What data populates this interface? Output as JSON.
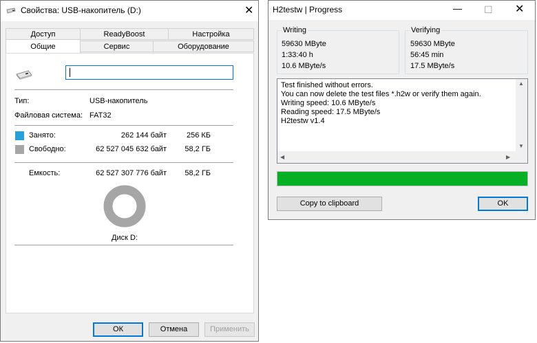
{
  "props_dialog": {
    "title": "Свойства: USB-накопитель (D:)",
    "close_glyph": "✕",
    "tabs_row1": [
      "Доступ",
      "ReadyBoost",
      "Настройка"
    ],
    "tabs_row2": [
      "Общие",
      "Сервис",
      "Оборудование"
    ],
    "selected_tab": "Общие",
    "name_value": "",
    "type_label": "Тип:",
    "type_value": "USB-накопитель",
    "fs_label": "Файловая система:",
    "fs_value": "FAT32",
    "used_label": "Занято:",
    "used_bytes": "262 144 байт",
    "used_short": "256 КБ",
    "free_label": "Свободно:",
    "free_bytes": "62 527 045 632 байт",
    "free_short": "58,2 ГБ",
    "capacity_label": "Емкость:",
    "capacity_bytes": "62 527 307 776 байт",
    "capacity_short": "58,2 ГБ",
    "disk_label": "Диск D:",
    "used_fraction": 4.2e-06,
    "used_color": "#26a0da",
    "free_color": "#a6a6a6",
    "ok_label": "ОК",
    "cancel_label": "Отмена",
    "apply_label": "Применить"
  },
  "progress_dialog": {
    "title": "H2testw | Progress",
    "minimize_glyph": "—",
    "maximize_glyph": "☐",
    "close_glyph": "✕",
    "writing": {
      "title": "Writing",
      "size": "59630 MByte",
      "time": "1:33:40 h",
      "speed": "10.6 MByte/s"
    },
    "verifying": {
      "title": "Verifying",
      "size": "59630 MByte",
      "time": "56:45 min",
      "speed": "17.5 MByte/s"
    },
    "log_lines": [
      "Test finished without errors.",
      "You can now delete the test files *.h2w or verify them again.",
      "Writing speed: 10.6 MByte/s",
      "Reading speed: 17.5 MByte/s",
      "H2testw v1.4"
    ],
    "progress_fraction": 1.0,
    "progress_color": "#06b025",
    "copy_label": "Copy to clipboard",
    "ok_label": "OK"
  }
}
